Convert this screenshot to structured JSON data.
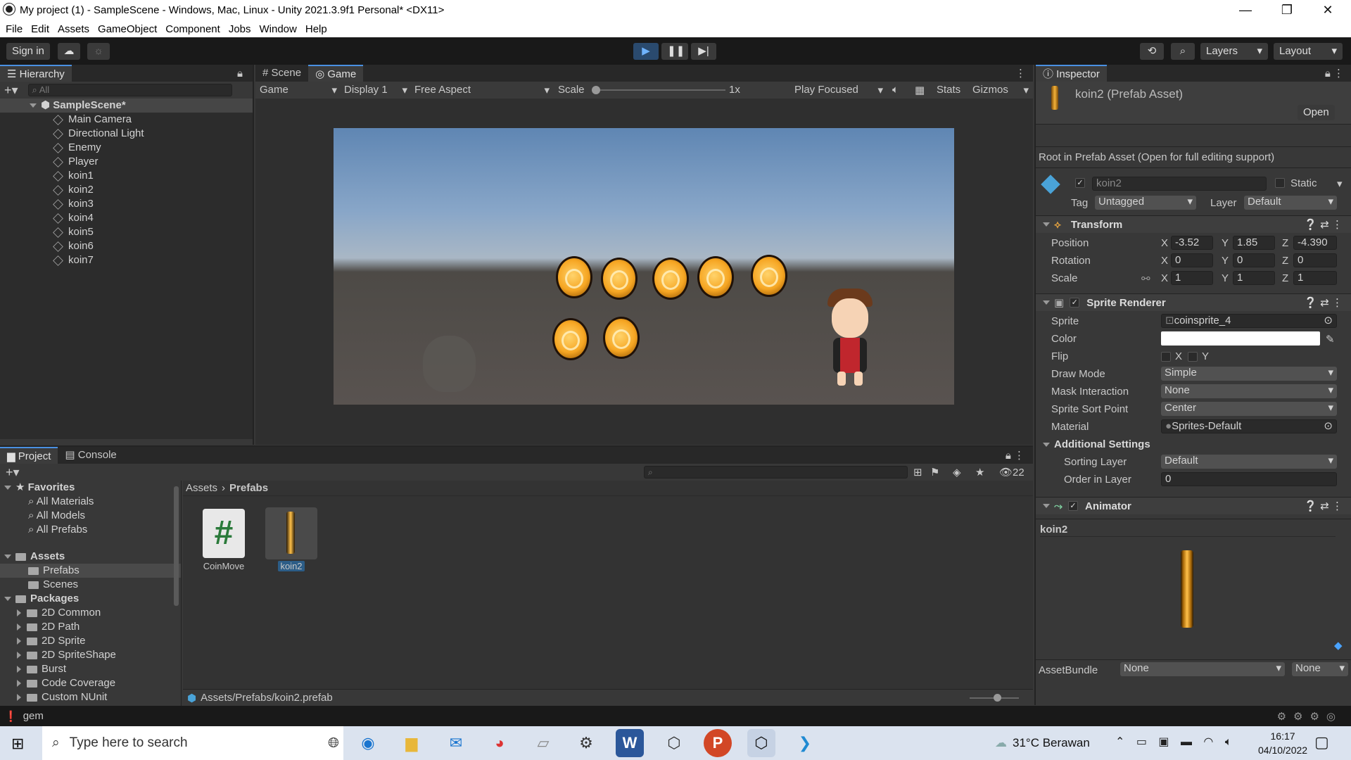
{
  "window": {
    "title": "My project (1) - SampleScene - Windows, Mac, Linux - Unity 2021.3.9f1 Personal* <DX11>",
    "minimize": "—",
    "maximize": "❐",
    "close": "✕"
  },
  "menu": [
    "File",
    "Edit",
    "Assets",
    "GameObject",
    "Component",
    "Jobs",
    "Window",
    "Help"
  ],
  "toolbar": {
    "sign_in": "Sign in",
    "layers": "Layers",
    "layout": "Layout"
  },
  "hierarchy": {
    "tab": "Hierarchy",
    "search_placeholder": "All",
    "scene": "SampleScene*",
    "items": [
      "Main Camera",
      "Directional Light",
      "Enemy",
      "Player",
      "koin1",
      "koin2",
      "koin3",
      "koin4",
      "koin5",
      "koin6",
      "koin7"
    ]
  },
  "game_view": {
    "tabs": [
      "Scene",
      "Game"
    ],
    "mode": "Game",
    "display": "Display 1",
    "aspect": "Free Aspect",
    "scale_label": "Scale",
    "scale_value": "1x",
    "play_focused": "Play Focused",
    "stats": "Stats",
    "gizmos": "Gizmos"
  },
  "project": {
    "tabs": [
      "Project",
      "Console"
    ],
    "hidden_count": "22",
    "favorites_label": "Favorites",
    "favorites": [
      "All Materials",
      "All Models",
      "All Prefabs"
    ],
    "assets_label": "Assets",
    "assets": [
      "Prefabs",
      "Scenes"
    ],
    "packages_label": "Packages",
    "packages": [
      "2D Common",
      "2D Path",
      "2D Sprite",
      "2D SpriteShape",
      "Burst",
      "Code Coverage",
      "Custom NUnit"
    ],
    "breadcrumb": [
      "Assets",
      "Prefabs"
    ],
    "files": [
      {
        "name": "CoinMove",
        "icon": "#"
      },
      {
        "name": "koin2",
        "icon": ""
      }
    ],
    "selected_path": "Assets/Prefabs/koin2.prefab"
  },
  "inspector": {
    "tab": "Inspector",
    "asset_name": "koin2 (Prefab Asset)",
    "open_button": "Open",
    "root_note": "Root in Prefab Asset (Open for full editing support)",
    "object_name": "koin2",
    "static_label": "Static",
    "tag_label": "Tag",
    "tag_value": "Untagged",
    "layer_label": "Layer",
    "layer_value": "Default",
    "transform": {
      "title": "Transform",
      "position": {
        "label": "Position",
        "x": "-3.52",
        "y": "1.85",
        "z": "-4.390"
      },
      "rotation": {
        "label": "Rotation",
        "x": "0",
        "y": "0",
        "z": "0"
      },
      "scale": {
        "label": "Scale",
        "x": "1",
        "y": "1",
        "z": "1"
      }
    },
    "sprite_renderer": {
      "title": "Sprite Renderer",
      "sprite_label": "Sprite",
      "sprite_value": "coinsprite_4",
      "color_label": "Color",
      "flip_label": "Flip",
      "flip_x": "X",
      "flip_y": "Y",
      "draw_mode_label": "Draw Mode",
      "draw_mode_value": "Simple",
      "mask_label": "Mask Interaction",
      "mask_value": "None",
      "sort_point_label": "Sprite Sort Point",
      "sort_point_value": "Center",
      "material_label": "Material",
      "material_value": "Sprites-Default",
      "additional": "Additional Settings",
      "sorting_layer_label": "Sorting Layer",
      "sorting_layer_value": "Default",
      "order_label": "Order in Layer",
      "order_value": "0"
    },
    "animator": {
      "title": "Animator"
    },
    "preview_name": "koin2",
    "assetbundle_label": "AssetBundle",
    "assetbundle_value": "None",
    "assetbundle_variant": "None"
  },
  "status": {
    "text": "gem"
  },
  "taskbar": {
    "search_placeholder": "Type here to search",
    "weather": "31°C  Berawan",
    "time": "16:17",
    "date": "04/10/2022"
  }
}
